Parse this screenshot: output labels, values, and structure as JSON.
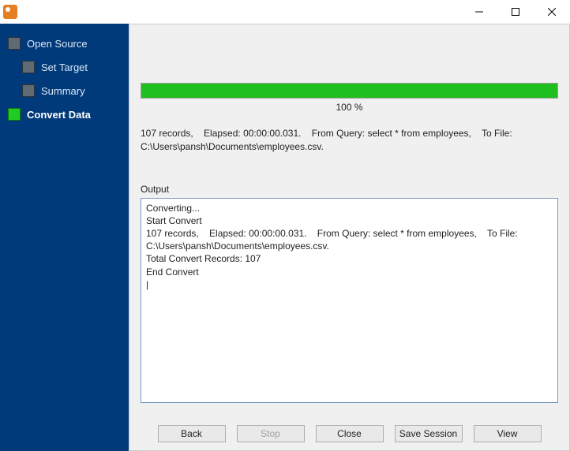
{
  "title": "",
  "sidebar": {
    "items": [
      {
        "label": "Open Source",
        "indent": 0,
        "active": false
      },
      {
        "label": "Set Target",
        "indent": 1,
        "active": false
      },
      {
        "label": "Summary",
        "indent": 1,
        "active": false
      },
      {
        "label": "Convert Data",
        "indent": 0,
        "active": true
      }
    ]
  },
  "progress": {
    "percent": 100,
    "label": "100 %"
  },
  "summaryText": "107 records,    Elapsed: 00:00:00.031.    From Query: select * from employees,    To File: C:\\Users\\pansh\\Documents\\employees.csv.",
  "outputLabel": "Output",
  "outputLines": [
    "Converting...",
    "Start Convert",
    "107 records,    Elapsed: 00:00:00.031.    From Query: select * from employees,    To File: C:\\Users\\pansh\\Documents\\employees.csv.",
    "Total Convert Records: 107",
    "End Convert"
  ],
  "buttons": {
    "back": "Back",
    "stop": "Stop",
    "close": "Close",
    "saveSession": "Save Session",
    "view": "View"
  },
  "buttonStates": {
    "stopDisabled": true
  }
}
